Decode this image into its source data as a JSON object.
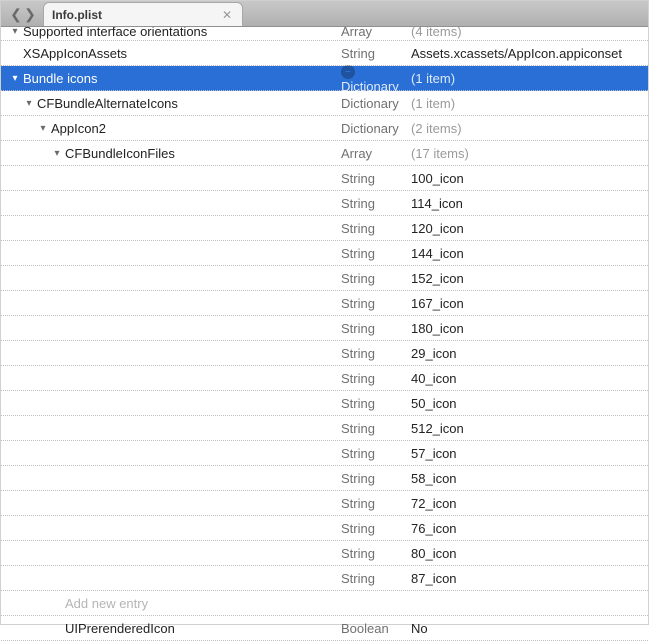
{
  "tab": {
    "title": "Info.plist"
  },
  "types": {
    "array": "Array",
    "string": "String",
    "dictionary": "Dictionary",
    "boolean": "Boolean"
  },
  "placeholder": {
    "add_entry": "Add new entry"
  },
  "rows": {
    "supported_orientations": {
      "key": "Supported interface orientations",
      "value": "(4 items)"
    },
    "xs_appicon_assets": {
      "key": "XSAppIconAssets",
      "value": "Assets.xcassets/AppIcon.appiconset"
    },
    "bundle_icons": {
      "key": "Bundle icons",
      "value": "(1 item)"
    },
    "cf_alt_icons": {
      "key": "CFBundleAlternateIcons",
      "value": "(1 item)"
    },
    "appicon2": {
      "key": "AppIcon2",
      "value": "(2 items)"
    },
    "cf_icon_files": {
      "key": "CFBundleIconFiles",
      "value": "(17 items)"
    },
    "ui_prerendered": {
      "key": "UIPrerenderedIcon",
      "value": "No"
    }
  },
  "icon_files": [
    "100_icon",
    "114_icon",
    "120_icon",
    "144_icon",
    "152_icon",
    "167_icon",
    "180_icon",
    "29_icon",
    "40_icon",
    "50_icon",
    "512_icon",
    "57_icon",
    "58_icon",
    "72_icon",
    "76_icon",
    "80_icon",
    "87_icon"
  ]
}
